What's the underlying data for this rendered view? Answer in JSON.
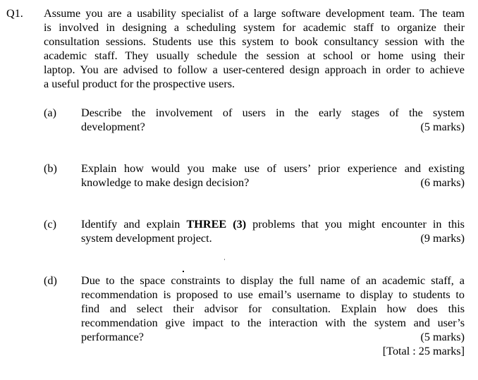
{
  "question": {
    "number": "Q1.",
    "stem_lines": [
      "Assume you are a usability specialist of a large software development team. The team",
      "is involved in designing a scheduling system for academic staff to organize their",
      "consultation sessions. Students use this system to book consultancy session with the",
      "academic staff.  They usually schedule the session at school or home using their",
      "laptop. You are advised to follow a user-centered design approach in order to achieve",
      "a useful product for the prospective users."
    ],
    "parts": [
      {
        "label": "(a)",
        "lines": [
          "Describe the involvement of users in the early stages of the system",
          "development?"
        ],
        "marks": "(5 marks)"
      },
      {
        "label": "(b)",
        "lines": [
          "Explain how would you make use of users’ prior experience and existing",
          "knowledge to make design decision?"
        ],
        "marks": "(6 marks)"
      },
      {
        "label": "(c)",
        "line1_pre": "Identify and explain ",
        "line1_bold": "THREE (3)",
        "line1_post": " problems that you might encounter in this",
        "line2": "system development project.",
        "marks": "(9 marks)"
      },
      {
        "label": "(d)",
        "lines": [
          "Due to the space constraints to display the full name of an academic staff, a",
          "recommendation is proposed to use email’s username to display to students to",
          "find and select their advisor for consultation. Explain how does this",
          "recommendation give impact to the interaction with the system and user’s",
          "performance?"
        ],
        "marks": "(5 marks)"
      }
    ],
    "total": "[Total : 25 marks]"
  }
}
